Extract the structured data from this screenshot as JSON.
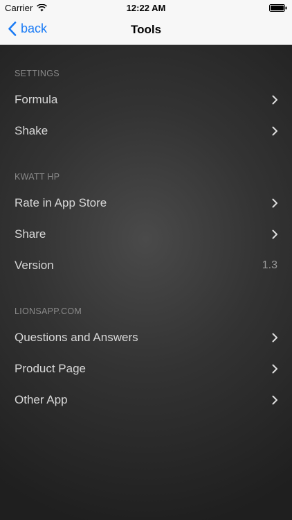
{
  "status_bar": {
    "carrier": "Carrier",
    "wifi_icon": "wifi-icon",
    "time": "12:22 AM",
    "battery_icon": "battery-icon"
  },
  "nav_bar": {
    "back_label": "back",
    "back_icon": "chevron-left-icon",
    "title": "Tools",
    "accent_color": "#1a7bf5"
  },
  "sections": [
    {
      "header": "SETTINGS",
      "rows": [
        {
          "label": "Formula",
          "accessory": "chevron-right-icon"
        },
        {
          "label": "Shake",
          "accessory": "chevron-right-icon"
        }
      ]
    },
    {
      "header": "KWATT HP",
      "rows": [
        {
          "label": "Rate in App Store",
          "accessory": "chevron-right-icon"
        },
        {
          "label": "Share",
          "accessory": "chevron-right-icon"
        },
        {
          "label": "Version",
          "value": "1.3"
        }
      ]
    },
    {
      "header": "LIONSAPP.COM",
      "rows": [
        {
          "label": "Questions and Answers",
          "accessory": "chevron-right-icon"
        },
        {
          "label": "Product Page",
          "accessory": "chevron-right-icon"
        },
        {
          "label": "Other App",
          "accessory": "chevron-right-icon"
        }
      ]
    }
  ]
}
